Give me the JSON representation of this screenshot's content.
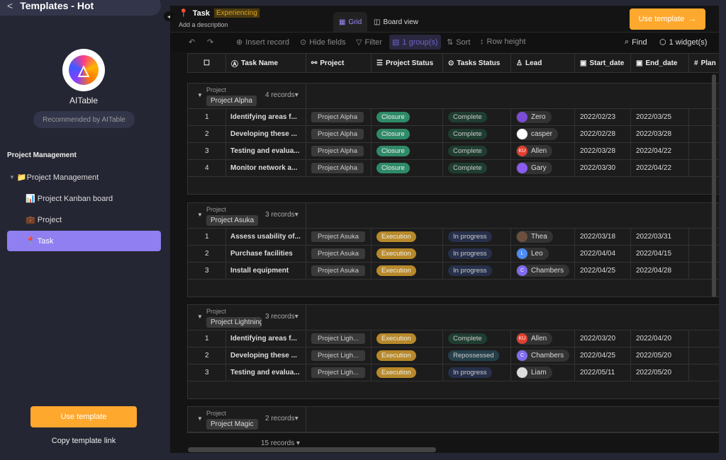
{
  "sidebar": {
    "title": "Templates - Hot",
    "brand": "AITable",
    "recommended": "Recommended by AITable",
    "section": "Project Management",
    "items": [
      {
        "icon": "📁",
        "label": "Project Management"
      },
      {
        "icon": "📊",
        "label": "Project Kanban board"
      },
      {
        "icon": "💼",
        "label": "Project"
      },
      {
        "icon": "📍",
        "label": "Task"
      }
    ],
    "use_template": "Use template",
    "copy_link": "Copy template link"
  },
  "header": {
    "title": "Task",
    "badge": "Experiencing",
    "description": "Add a description",
    "tabs": [
      "Grid",
      "Board view"
    ],
    "use_template": "Use template"
  },
  "toolbar": {
    "insert": "Insert record",
    "hide": "Hide fields",
    "filter": "Filter",
    "group": "1 group(s)",
    "sort": "Sort",
    "row_height": "Row height",
    "find": "Find",
    "widgets": "1 widget(s)"
  },
  "columns": [
    "Task Name",
    "Project",
    "Project Status",
    "Tasks Status",
    "Lead",
    "Start_date",
    "End_date",
    "Plan"
  ],
  "colors": {
    "closure": "#2f8a68",
    "execution": "#b8892a",
    "complete": "#1f3d30",
    "in_progress": "#27304a",
    "repossessed": "#24404a",
    "accent": "#ffa82e"
  },
  "groups": [
    {
      "label": "Project",
      "name": "Project Alpha",
      "count": "4 records",
      "rows": [
        [
          "1",
          "Identifying areas f...",
          "Project Alpha",
          "Closure",
          "Complete",
          "Zero",
          "2022/02/23",
          "2022/03/25"
        ],
        [
          "2",
          "Developing these ...",
          "Project Alpha",
          "Closure",
          "Complete",
          "casper",
          "2022/02/28",
          "2022/03/28"
        ],
        [
          "3",
          "Testing and evalua...",
          "Project Alpha",
          "Closure",
          "Complete",
          "Allen",
          "2022/03/28",
          "2022/04/22"
        ],
        [
          "4",
          "Monitor network a...",
          "Project Alpha",
          "Closure",
          "Complete",
          "Gary",
          "2022/03/30",
          "2022/04/22"
        ]
      ]
    },
    {
      "label": "Project",
      "name": "Project Asuka",
      "count": "3 records",
      "rows": [
        [
          "1",
          "Assess usability of...",
          "Project Asuka",
          "Execution",
          "In progress",
          "Thea",
          "2022/03/18",
          "2022/03/31"
        ],
        [
          "2",
          "Purchase facilities",
          "Project Asuka",
          "Execution",
          "In progress",
          "Leo",
          "2022/04/04",
          "2022/04/15"
        ],
        [
          "3",
          "Install equipment",
          "Project Asuka",
          "Execution",
          "In progress",
          "Chambers",
          "2022/04/25",
          "2022/04/28"
        ]
      ]
    },
    {
      "label": "Project",
      "name": "Project Lightning",
      "count": "3 records",
      "rows": [
        [
          "1",
          "Identifying areas f...",
          "Project Ligh...",
          "Execution",
          "Complete",
          "Allen",
          "2022/03/20",
          "2022/04/20"
        ],
        [
          "2",
          "Developing these ...",
          "Project Ligh...",
          "Execution",
          "Repossessed",
          "Chambers",
          "2022/04/25",
          "2022/05/20"
        ],
        [
          "3",
          "Testing and evalua...",
          "Project Ligh...",
          "Execution",
          "In progress",
          "Liam",
          "2022/05/11",
          "2022/05/20"
        ]
      ]
    },
    {
      "label": "Project",
      "name": "Project Magic",
      "count": "2 records",
      "rows": []
    }
  ],
  "footer": {
    "total": "15 records"
  }
}
